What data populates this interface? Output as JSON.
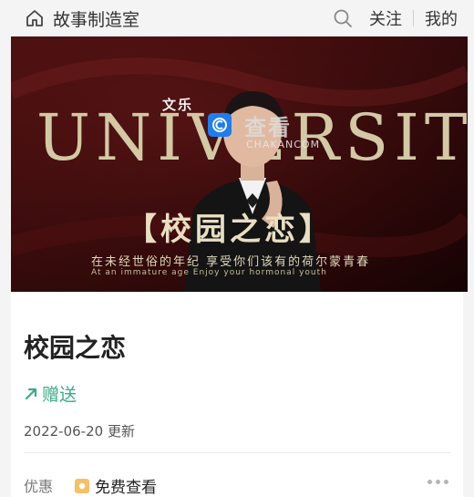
{
  "header": {
    "brand": "故事制造室",
    "follow_label": "关注",
    "mine_label": "我的"
  },
  "banner": {
    "word": "UNIVERSITY",
    "publisher": "文乐",
    "watermark_cn": "查看",
    "watermark_en": "CHAKANCOM",
    "title": "【校园之恋】",
    "subtitle": "在未经世俗的年纪 享受你们该有的荷尔蒙青春",
    "subtitle_en": "At an immature age Enjoy your hormonal youth"
  },
  "story": {
    "title": "校园之恋",
    "gift_label": "赠送",
    "updated": "2022-06-20 更新",
    "promo_label": "优惠",
    "free_label": "免费查看"
  },
  "colors": {
    "accent_green": "#3aab85",
    "banner_bg": "#3c0a0b",
    "gold": "#d3c9a5"
  }
}
